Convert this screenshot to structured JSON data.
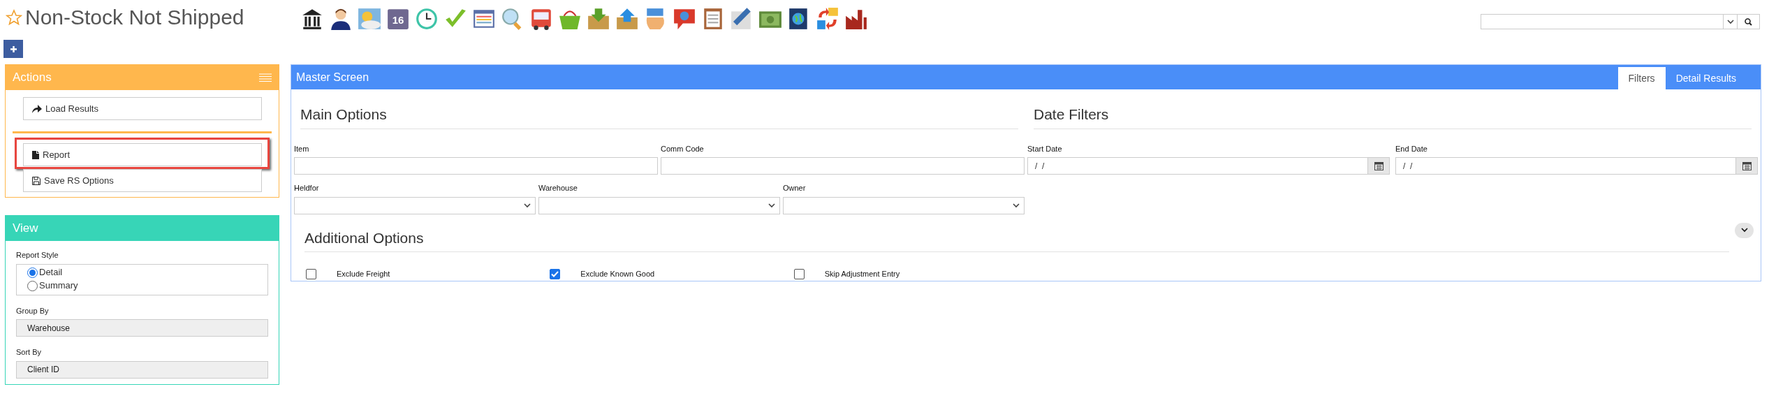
{
  "page": {
    "title": "Non-Stock Not Shipped"
  },
  "toolbar": {
    "calendar_day": "16"
  },
  "actions": {
    "title": "Actions",
    "buttons": [
      {
        "kind": "load",
        "label": "Load Results",
        "highlighted": false
      },
      {
        "kind": "report",
        "label": "Report",
        "highlighted": true
      },
      {
        "kind": "save",
        "label": "Save RS Options",
        "highlighted": false
      }
    ]
  },
  "view": {
    "title": "View",
    "report_style": {
      "label": "Report Style",
      "options": [
        {
          "label": "Detail",
          "selected": true
        },
        {
          "label": "Summary",
          "selected": false
        }
      ]
    },
    "group_by": {
      "label": "Group By",
      "value": "Warehouse"
    },
    "sort_by": {
      "label": "Sort By",
      "value": "Client ID"
    }
  },
  "master": {
    "title": "Master Screen",
    "tabs": [
      {
        "label": "Filters",
        "selected": true
      },
      {
        "label": "Detail Results",
        "selected": false
      }
    ],
    "main_options": {
      "title": "Main Options",
      "text_fields": [
        {
          "label": "Item"
        },
        {
          "label": "Comm Code"
        }
      ],
      "select_fields": [
        {
          "label": "Heldfor"
        },
        {
          "label": "Warehouse"
        },
        {
          "label": "Owner"
        }
      ]
    },
    "date_filters": {
      "title": "Date Filters",
      "fields": [
        {
          "label": "Start Date",
          "value": "/  /"
        },
        {
          "label": "End Date",
          "value": "/  /"
        }
      ]
    },
    "additional_options": {
      "title": "Additional Options",
      "checkboxes": [
        {
          "label": "Exclude Freight",
          "checked": false
        },
        {
          "label": "Exclude Known Good",
          "checked": true
        },
        {
          "label": "Skip Adjustment Entry",
          "checked": false
        }
      ]
    }
  }
}
